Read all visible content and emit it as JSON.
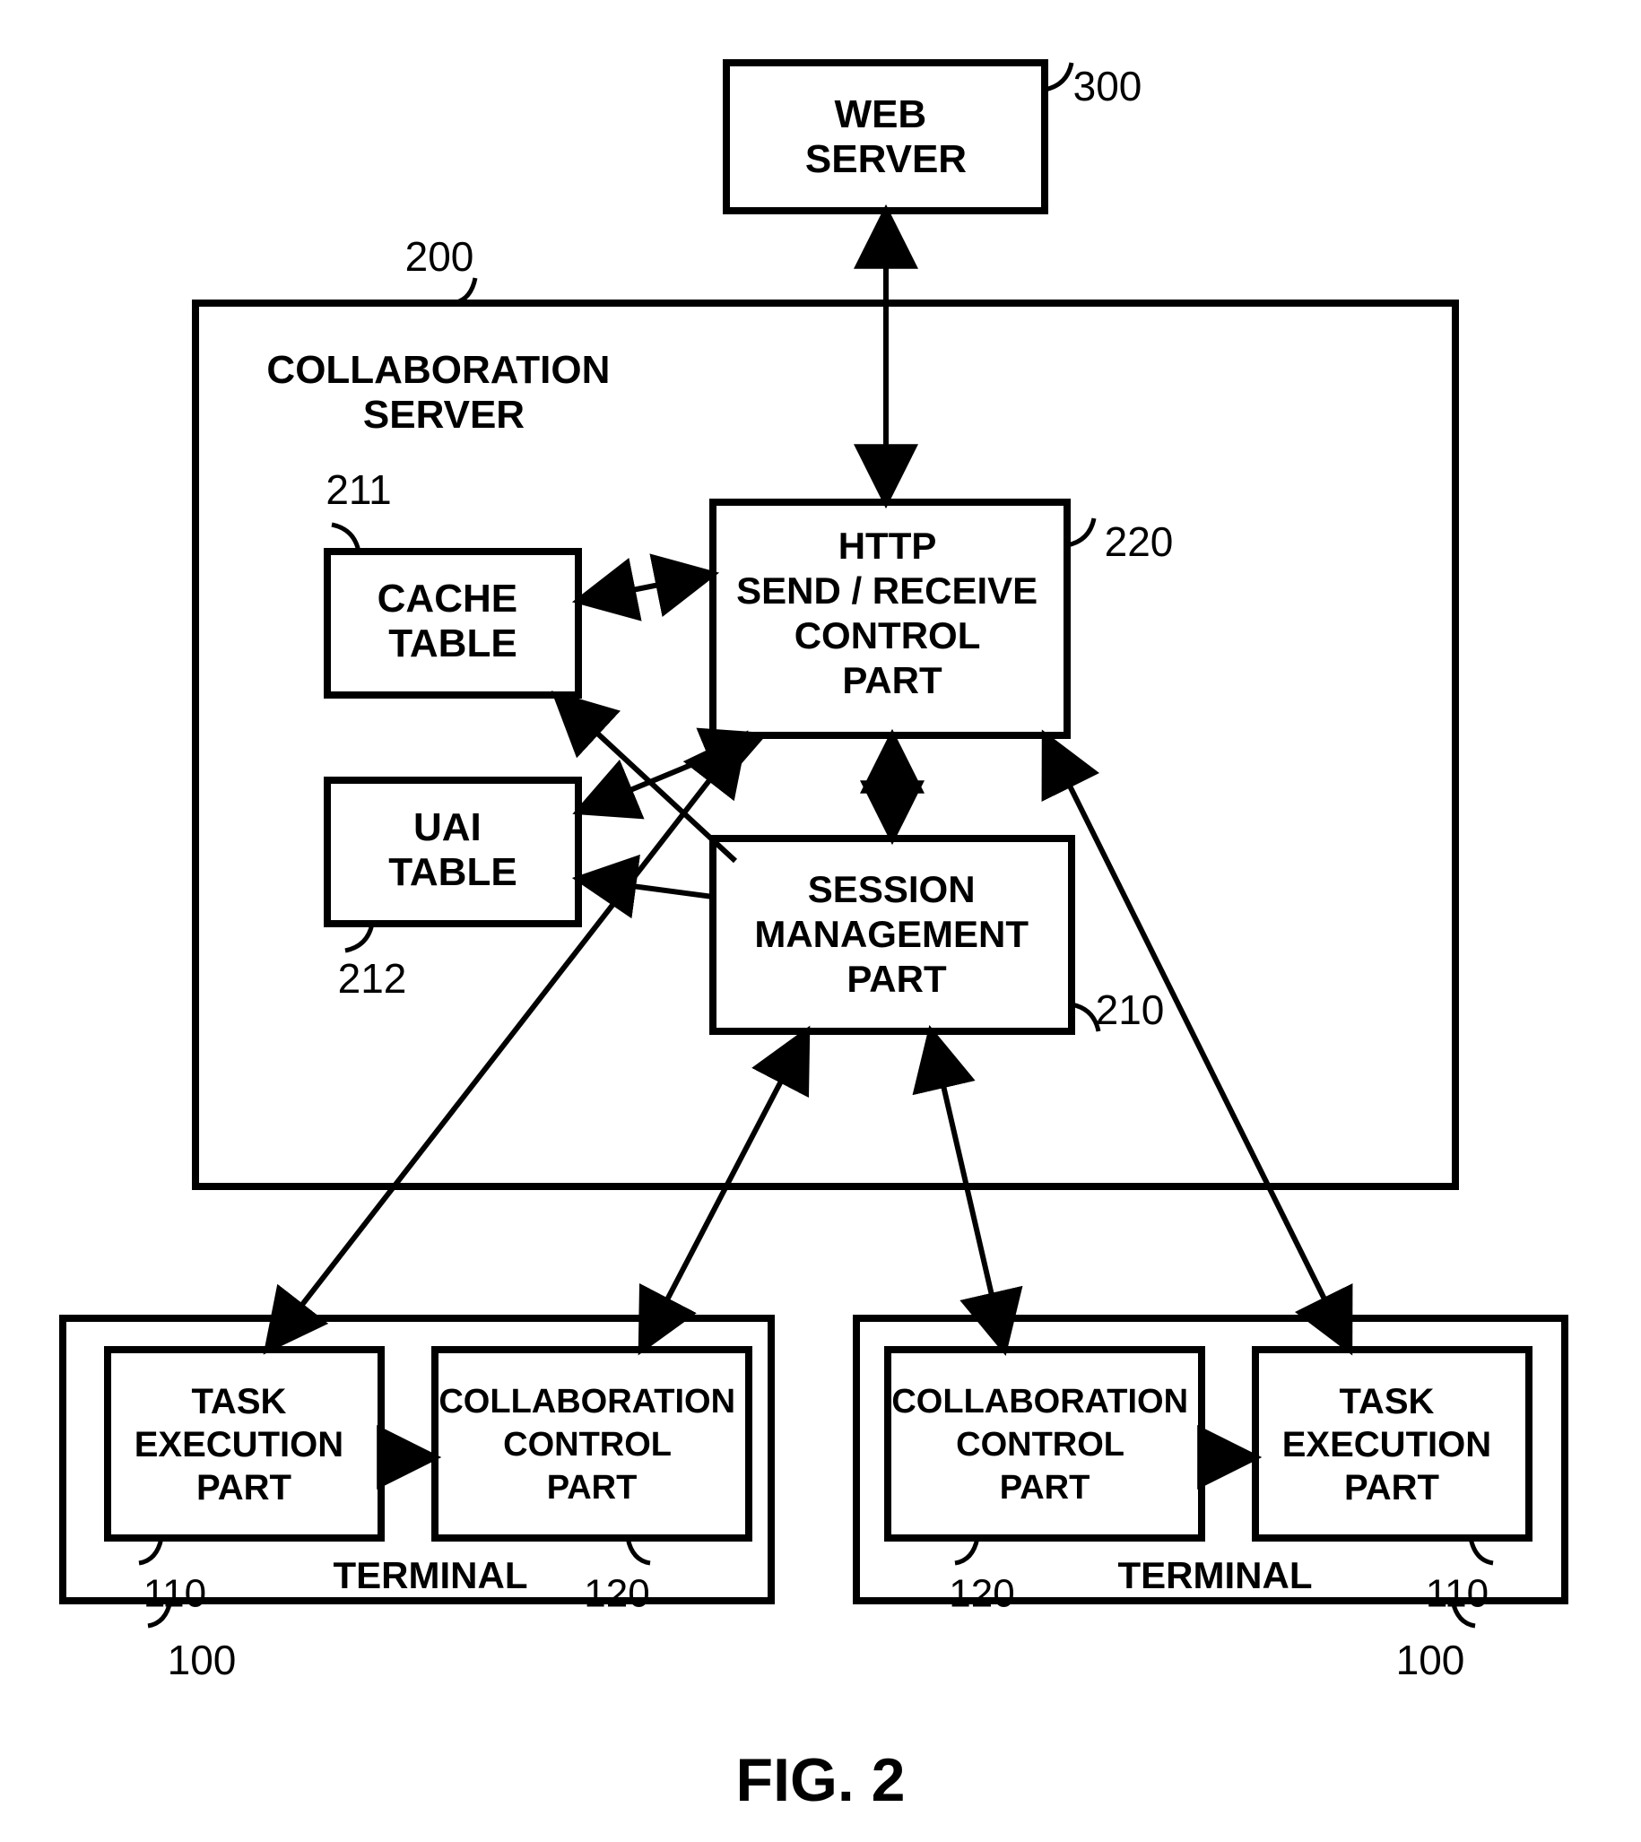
{
  "figure_title": "FIG. 2",
  "refs": {
    "collab_server": "200",
    "web_server": "300",
    "cache_table": "211",
    "uai_table": "212",
    "session_mgmt": "210",
    "http_ctrl": "220",
    "terminal_left": "100",
    "terminal_right": "100",
    "task_exec_left": "110",
    "task_exec_right": "110",
    "collab_ctrl_left": "120",
    "collab_ctrl_right": "120"
  },
  "labels": {
    "collab_server": "COLLABORATION\nSERVER",
    "web_server": "WEB\nSERVER",
    "cache_table": "CACHE\nTABLE",
    "uai_table": "UAI\nTABLE",
    "http_ctrl": "HTTP\nSEND / RECEIVE\nCONTROL\nPART",
    "session_mgmt": "SESSION\nMANAGEMENT\nPART",
    "terminal": "TERMINAL",
    "task_exec": "TASK\nEXECUTION\nPART",
    "collab_ctrl": "COLLABORATION\nCONTROL\nPART"
  }
}
